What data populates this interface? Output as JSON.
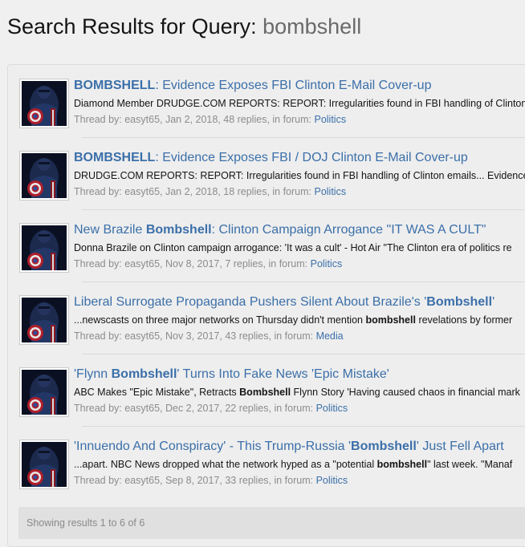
{
  "page": {
    "title_prefix": "Search Results for Query: ",
    "query": "bombshell"
  },
  "results": [
    {
      "title_before": "",
      "title_match": "BOMBSHELL",
      "title_after": ": Evidence Exposes FBI Clinton E-Mail Cover-up",
      "snippet_before": "Diamond Member DRUDGE.COM REPORTS: REPORT: Irregularities found in FBI handling of Clinton",
      "snippet_match": "",
      "snippet_after": "",
      "meta_prefix": "Thread by: ",
      "author": "easyt65",
      "meta_mid": ", Jan 2, 2018, 48 replies, in forum: ",
      "forum": "Politics"
    },
    {
      "title_before": "",
      "title_match": "BOMBSHELL",
      "title_after": ": Evidence Exposes FBI / DOJ Clinton E-Mail Cover-up",
      "snippet_before": "DRUDGE.COM REPORTS: REPORT: Irregularities found in FBI handling of Clinton emails... Evidence",
      "snippet_match": "",
      "snippet_after": "",
      "meta_prefix": "Thread by: ",
      "author": "easyt65",
      "meta_mid": ", Jan 2, 2018, 18 replies, in forum: ",
      "forum": "Politics"
    },
    {
      "title_before": "New Brazile ",
      "title_match": "Bombshell",
      "title_after": ": Clinton Campaign Arrogance \"IT WAS A CULT\"",
      "snippet_before": "Donna Brazile on Clinton campaign arrogance: 'It was a cult' - Hot Air \"The Clinton era of politics re",
      "snippet_match": "",
      "snippet_after": "",
      "meta_prefix": "Thread by: ",
      "author": "easyt65",
      "meta_mid": ", Nov 8, 2017, 7 replies, in forum: ",
      "forum": "Politics"
    },
    {
      "title_before": "Liberal Surrogate Propaganda Pushers Silent About Brazile's '",
      "title_match": "Bombshell",
      "title_after": "'",
      "snippet_before": "...newscasts on three major networks on Thursday didn't mention ",
      "snippet_match": "bombshell",
      "snippet_after": " revelations by former",
      "meta_prefix": "Thread by: ",
      "author": "easyt65",
      "meta_mid": ", Nov 3, 2017, 43 replies, in forum: ",
      "forum": "Media"
    },
    {
      "title_before": "'Flynn ",
      "title_match": "Bombshell",
      "title_after": "' Turns Into Fake News 'Epic Mistake'",
      "snippet_before": "ABC Makes \"Epic Mistake\", Retracts ",
      "snippet_match": "Bombshell",
      "snippet_after": " Flynn Story 'Having caused chaos in financial mark",
      "meta_prefix": "Thread by: ",
      "author": "easyt65",
      "meta_mid": ", Dec 2, 2017, 22 replies, in forum: ",
      "forum": "Politics"
    },
    {
      "title_before": "'Innuendo And Conspiracy' - This Trump-Russia '",
      "title_match": "Bombshell",
      "title_after": "' Just Fell Apart",
      "snippet_before": "...apart. NBC News dropped what the network hyped as a \"potential ",
      "snippet_match": "bombshell",
      "snippet_after": "\" last week. \"Manaf",
      "meta_prefix": "Thread by: ",
      "author": "easyt65",
      "meta_mid": ", Sep 8, 2017, 33 replies, in forum: ",
      "forum": "Politics"
    }
  ],
  "footer": {
    "text": "Showing results 1 to 6 of 6"
  },
  "colors": {
    "link": "#3b6fa9",
    "meta_text": "#8c8c8c",
    "background": "#f0f0f0"
  },
  "icons": {
    "avatar": "captain-america-avatar-icon"
  }
}
